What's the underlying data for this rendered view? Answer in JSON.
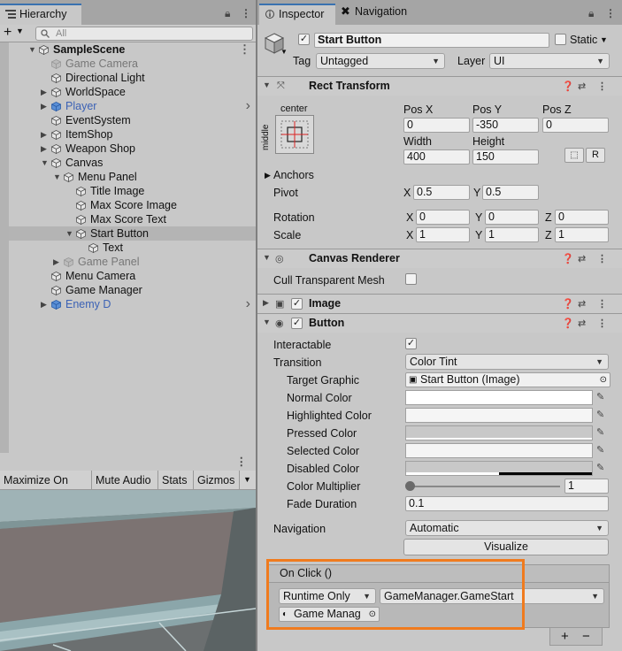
{
  "hierarchy": {
    "tab_label": "Hierarchy",
    "search_placeholder": "All",
    "add_label": "+",
    "items": [
      {
        "label": "SampleScene",
        "depth": 0,
        "arrow": "expanded",
        "kind": "scene"
      },
      {
        "label": "Game Camera",
        "depth": 1,
        "arrow": "none",
        "kind": "faded"
      },
      {
        "label": "Directional Light",
        "depth": 1,
        "arrow": "none",
        "kind": "normal"
      },
      {
        "label": "WorldSpace",
        "depth": 1,
        "arrow": "collapsed",
        "kind": "normal"
      },
      {
        "label": "Player",
        "depth": 1,
        "arrow": "collapsed",
        "kind": "prefab"
      },
      {
        "label": "EventSystem",
        "depth": 1,
        "arrow": "none",
        "kind": "normal"
      },
      {
        "label": "ItemShop",
        "depth": 1,
        "arrow": "collapsed",
        "kind": "normal"
      },
      {
        "label": "Weapon Shop",
        "depth": 1,
        "arrow": "collapsed",
        "kind": "normal"
      },
      {
        "label": "Canvas",
        "depth": 1,
        "arrow": "expanded",
        "kind": "normal"
      },
      {
        "label": "Menu Panel",
        "depth": 2,
        "arrow": "expanded",
        "kind": "normal"
      },
      {
        "label": "Title Image",
        "depth": 3,
        "arrow": "none",
        "kind": "normal"
      },
      {
        "label": "Max Score Image",
        "depth": 3,
        "arrow": "none",
        "kind": "normal"
      },
      {
        "label": "Max Score Text",
        "depth": 3,
        "arrow": "none",
        "kind": "normal"
      },
      {
        "label": "Start Button",
        "depth": 3,
        "arrow": "expanded",
        "kind": "selected"
      },
      {
        "label": "Text",
        "depth": 4,
        "arrow": "none",
        "kind": "normal"
      },
      {
        "label": "Game Panel",
        "depth": 2,
        "arrow": "collapsed",
        "kind": "faded"
      },
      {
        "label": "Menu Camera",
        "depth": 1,
        "arrow": "none",
        "kind": "normal"
      },
      {
        "label": "Game Manager",
        "depth": 1,
        "arrow": "none",
        "kind": "normal"
      },
      {
        "label": "Enemy D",
        "depth": 1,
        "arrow": "collapsed",
        "kind": "prefab"
      }
    ]
  },
  "game_view": {
    "buttons": [
      "Maximize On Play",
      "Mute Audio",
      "Stats",
      "Gizmos"
    ]
  },
  "inspector": {
    "tabs": [
      "Inspector",
      "Navigation"
    ],
    "object": {
      "name": "Start Button",
      "active": true,
      "static_label": "Static",
      "tag_label": "Tag",
      "tag_value": "Untagged",
      "layer_label": "Layer",
      "layer_value": "UI"
    },
    "rect_transform": {
      "title": "Rect Transform",
      "anchor_h": "center",
      "anchor_v": "middle",
      "pos_x_label": "Pos X",
      "pos_x": "0",
      "pos_y_label": "Pos Y",
      "pos_y": "-350",
      "pos_z_label": "Pos Z",
      "pos_z": "0",
      "width_label": "Width",
      "width": "400",
      "height_label": "Height",
      "height": "150",
      "r_label": "R",
      "anchors_label": "Anchors",
      "pivot_label": "Pivot",
      "pivot_x": "0.5",
      "pivot_y": "0.5",
      "rotation_label": "Rotation",
      "rot_x": "0",
      "rot_y": "0",
      "rot_z": "0",
      "scale_label": "Scale",
      "scale_x": "1",
      "scale_y": "1",
      "scale_z": "1",
      "x_label": "X",
      "y_label": "Y",
      "z_label": "Z"
    },
    "canvas_renderer": {
      "title": "Canvas Renderer",
      "cull_label": "Cull Transparent Mesh",
      "cull": false
    },
    "image": {
      "title": "Image",
      "enabled": true
    },
    "button": {
      "title": "Button",
      "enabled": true,
      "interactable_label": "Interactable",
      "interactable": true,
      "transition_label": "Transition",
      "transition_value": "Color Tint",
      "target_graphic_label": "Target Graphic",
      "target_graphic_value": "Start Button (Image)",
      "normal_color_label": "Normal Color",
      "highlighted_color_label": "Highlighted Color",
      "pressed_color_label": "Pressed Color",
      "selected_color_label": "Selected Color",
      "disabled_color_label": "Disabled Color",
      "color_multiplier_label": "Color Multiplier",
      "color_multiplier_value": "1",
      "fade_duration_label": "Fade Duration",
      "fade_duration_value": "0.1",
      "navigation_label": "Navigation",
      "navigation_value": "Automatic",
      "visualize_label": "Visualize",
      "onclick_label": "On Click ()",
      "runtime_value": "Runtime Only",
      "function_value": "GameManager.GameStart",
      "object_value": "Game Manag",
      "add_label": "+",
      "remove_label": "−"
    }
  },
  "colors": {
    "accent": "#3a72b0",
    "highlight_box": "#f07b1e",
    "prefab_text": "#3c62b5"
  }
}
